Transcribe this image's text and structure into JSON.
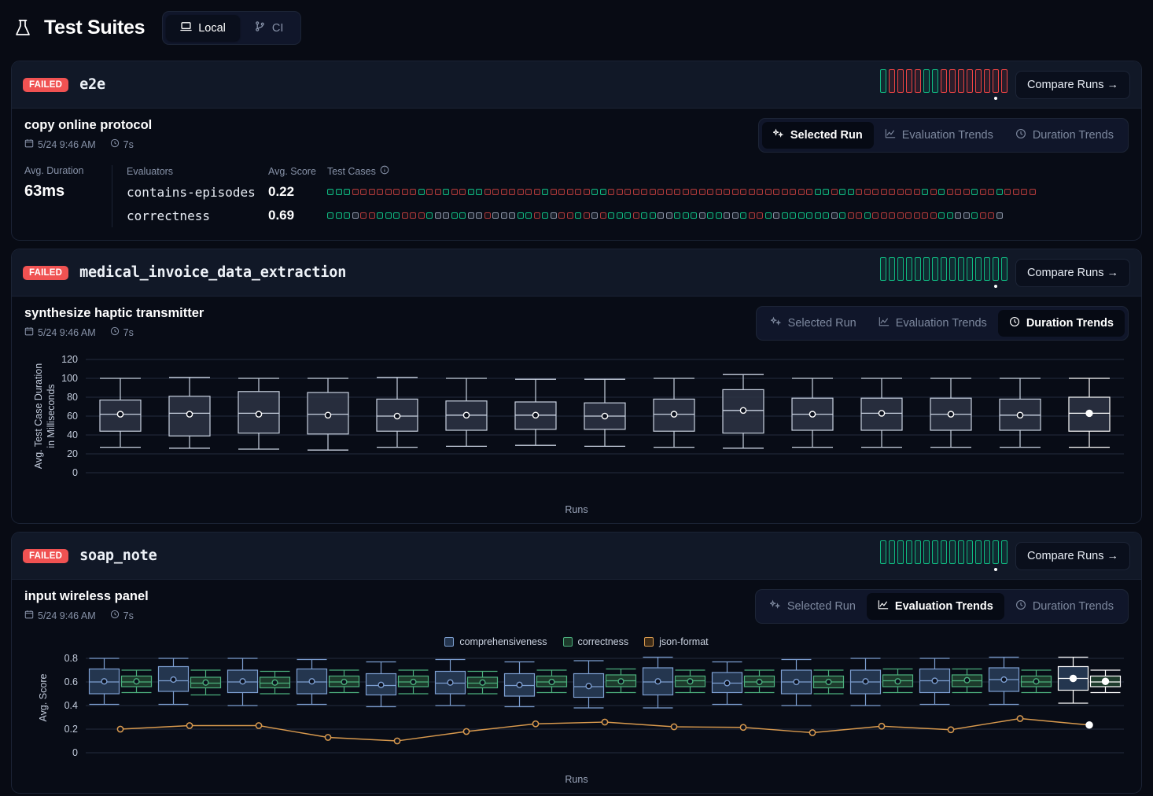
{
  "header": {
    "title": "Test Suites",
    "flask_icon": "flask-icon",
    "segments": [
      {
        "label": "Local",
        "icon": "laptop-icon",
        "active": true
      },
      {
        "label": "CI",
        "icon": "git-branch-icon",
        "active": false
      }
    ]
  },
  "labels": {
    "compare_runs": "Compare Runs →",
    "status_failed": "FAILED",
    "tab_selected_run": "Selected Run",
    "tab_evaluation_trends": "Evaluation Trends",
    "tab_duration_trends": "Duration Trends",
    "avg_duration": "Avg. Duration",
    "evaluators": "Evaluators",
    "avg_score": "Avg. Score",
    "test_cases": "Test Cases",
    "runs_axis": "Runs"
  },
  "colors": {
    "fail": "#f05252",
    "pass": "#10b981",
    "comprehensiveness": "#7d9fd1",
    "correctness": "#4caf7d",
    "json_format": "#d99a4e",
    "selected": "#ffffff"
  },
  "suites": [
    {
      "name": "e2e",
      "status": "FAILED",
      "run_bars": [
        "pass",
        "fail",
        "fail",
        "fail",
        "fail",
        "pass",
        "pass",
        "fail",
        "fail",
        "fail",
        "fail",
        "fail",
        "fail",
        "fail",
        "fail"
      ],
      "selected_bar_index": 13,
      "run": {
        "title": "copy online protocol",
        "date": "5/24 9:46 AM",
        "duration": "7s"
      },
      "active_tab": "Selected Run",
      "avg_duration": "63ms",
      "evaluators": [
        {
          "name": "contains-episodes",
          "avg_score": "0.22",
          "cases": [
            "p",
            "p",
            "p",
            "f",
            "f",
            "f",
            "f",
            "f",
            "f",
            "f",
            "f",
            "p",
            "f",
            "f",
            "p",
            "f",
            "f",
            "p",
            "p",
            "f",
            "f",
            "f",
            "f",
            "f",
            "f",
            "f",
            "p",
            "f",
            "f",
            "f",
            "f",
            "f",
            "p",
            "p",
            "f",
            "f",
            "f",
            "f",
            "f",
            "f",
            "f",
            "f",
            "f",
            "f",
            "f",
            "f",
            "f",
            "f",
            "f",
            "f",
            "f",
            "f",
            "f",
            "f",
            "f",
            "f",
            "f",
            "f",
            "f",
            "p",
            "p",
            "f",
            "p",
            "p",
            "f",
            "f",
            "f",
            "f",
            "f",
            "f",
            "f",
            "f",
            "p",
            "f",
            "p",
            "f",
            "f",
            "f",
            "p",
            "f",
            "f",
            "p",
            "f",
            "f",
            "f",
            "f"
          ]
        },
        {
          "name": "correctness",
          "avg_score": "0.69",
          "cases": [
            "p",
            "p",
            "p",
            "n",
            "f",
            "f",
            "p",
            "p",
            "p",
            "f",
            "f",
            "f",
            "p",
            "n",
            "n",
            "p",
            "p",
            "n",
            "n",
            "f",
            "n",
            "n",
            "n",
            "p",
            "p",
            "f",
            "p",
            "n",
            "f",
            "f",
            "p",
            "f",
            "n",
            "f",
            "p",
            "p",
            "p",
            "f",
            "p",
            "p",
            "n",
            "n",
            "p",
            "p",
            "p",
            "n",
            "p",
            "p",
            "n",
            "n",
            "p",
            "f",
            "f",
            "p",
            "n",
            "p",
            "p",
            "p",
            "p",
            "p",
            "p",
            "n",
            "p",
            "f",
            "f",
            "p",
            "f",
            "f",
            "f",
            "f",
            "f",
            "f",
            "f",
            "f",
            "p",
            "p",
            "n",
            "n",
            "p",
            "f",
            "f",
            "n"
          ]
        }
      ]
    },
    {
      "name": "medical_invoice_data_extraction",
      "status": "FAILED",
      "run_bars": [
        "pass",
        "pass",
        "pass",
        "pass",
        "pass",
        "pass",
        "pass",
        "pass",
        "pass",
        "pass",
        "pass",
        "pass",
        "pass",
        "pass",
        "pass"
      ],
      "selected_bar_index": 13,
      "run": {
        "title": "synthesize haptic transmitter",
        "date": "5/24 9:46 AM",
        "duration": "7s"
      },
      "active_tab": "Duration Trends"
    },
    {
      "name": "soap_note",
      "status": "FAILED",
      "run_bars": [
        "pass",
        "pass",
        "pass",
        "pass",
        "pass",
        "pass",
        "pass",
        "pass",
        "pass",
        "pass",
        "pass",
        "pass",
        "pass",
        "pass",
        "pass"
      ],
      "selected_bar_index": 13,
      "run": {
        "title": "input wireless panel",
        "date": "5/24 9:46 AM",
        "duration": "7s"
      },
      "active_tab": "Evaluation Trends"
    }
  ],
  "chart_data": [
    {
      "type": "box",
      "chart_id": "duration-trends",
      "title": "",
      "xlabel": "Runs",
      "ylabel": "Avg. Test Case Duration in Milliseconds",
      "ylim": [
        0,
        120
      ],
      "yticks": [
        0,
        20,
        40,
        60,
        80,
        100,
        120
      ],
      "grid": true,
      "selected_index": 14,
      "boxes": [
        {
          "min": 27,
          "q1": 44,
          "median": 62,
          "q3": 77,
          "max": 100,
          "mean": 62
        },
        {
          "min": 26,
          "q1": 39,
          "median": 63,
          "q3": 81,
          "max": 101,
          "mean": 62
        },
        {
          "min": 25,
          "q1": 42,
          "median": 63,
          "q3": 86,
          "max": 100,
          "mean": 62
        },
        {
          "min": 24,
          "q1": 41,
          "median": 62,
          "q3": 85,
          "max": 100,
          "mean": 61
        },
        {
          "min": 27,
          "q1": 44,
          "median": 60,
          "q3": 78,
          "max": 101,
          "mean": 60
        },
        {
          "min": 28,
          "q1": 45,
          "median": 61,
          "q3": 76,
          "max": 100,
          "mean": 61
        },
        {
          "min": 29,
          "q1": 46,
          "median": 61,
          "q3": 75,
          "max": 99,
          "mean": 61
        },
        {
          "min": 28,
          "q1": 46,
          "median": 60,
          "q3": 74,
          "max": 99,
          "mean": 60
        },
        {
          "min": 27,
          "q1": 44,
          "median": 62,
          "q3": 78,
          "max": 100,
          "mean": 62
        },
        {
          "min": 26,
          "q1": 42,
          "median": 66,
          "q3": 88,
          "max": 104,
          "mean": 66
        },
        {
          "min": 27,
          "q1": 45,
          "median": 62,
          "q3": 79,
          "max": 100,
          "mean": 62
        },
        {
          "min": 27,
          "q1": 45,
          "median": 63,
          "q3": 79,
          "max": 100,
          "mean": 63
        },
        {
          "min": 27,
          "q1": 45,
          "median": 62,
          "q3": 79,
          "max": 100,
          "mean": 62
        },
        {
          "min": 27,
          "q1": 45,
          "median": 61,
          "q3": 78,
          "max": 100,
          "mean": 61
        },
        {
          "min": 27,
          "q1": 44,
          "median": 63,
          "q3": 80,
          "max": 100,
          "mean": 63
        }
      ]
    },
    {
      "type": "box",
      "chart_id": "evaluation-trends",
      "title": "",
      "xlabel": "Runs",
      "ylabel": "Avg. Score",
      "ylim": [
        0,
        0.8
      ],
      "yticks": [
        0,
        0.2,
        0.4,
        0.6,
        0.8
      ],
      "grid": true,
      "selected_index": 14,
      "legend": [
        "comprehensiveness",
        "correctness",
        "json-format"
      ],
      "legend_position": "top-center",
      "series": [
        {
          "name": "comprehensiveness",
          "color": "#7d9fd1",
          "kind": "box",
          "boxes": [
            {
              "min": 0.41,
              "q1": 0.5,
              "median": 0.6,
              "q3": 0.71,
              "max": 0.8,
              "mean": 0.605
            },
            {
              "min": 0.41,
              "q1": 0.52,
              "median": 0.61,
              "q3": 0.73,
              "max": 0.8,
              "mean": 0.62
            },
            {
              "min": 0.4,
              "q1": 0.51,
              "median": 0.6,
              "q3": 0.7,
              "max": 0.8,
              "mean": 0.605
            },
            {
              "min": 0.41,
              "q1": 0.5,
              "median": 0.6,
              "q3": 0.71,
              "max": 0.79,
              "mean": 0.605
            },
            {
              "min": 0.39,
              "q1": 0.49,
              "median": 0.57,
              "q3": 0.67,
              "max": 0.77,
              "mean": 0.575
            },
            {
              "min": 0.4,
              "q1": 0.5,
              "median": 0.59,
              "q3": 0.69,
              "max": 0.79,
              "mean": 0.595
            },
            {
              "min": 0.39,
              "q1": 0.48,
              "median": 0.57,
              "q3": 0.67,
              "max": 0.77,
              "mean": 0.575
            },
            {
              "min": 0.38,
              "q1": 0.47,
              "median": 0.56,
              "q3": 0.67,
              "max": 0.78,
              "mean": 0.565
            },
            {
              "min": 0.38,
              "q1": 0.49,
              "median": 0.6,
              "q3": 0.72,
              "max": 0.81,
              "mean": 0.605
            },
            {
              "min": 0.41,
              "q1": 0.51,
              "median": 0.59,
              "q3": 0.68,
              "max": 0.77,
              "mean": 0.59
            },
            {
              "min": 0.4,
              "q1": 0.5,
              "median": 0.6,
              "q3": 0.7,
              "max": 0.79,
              "mean": 0.6
            },
            {
              "min": 0.4,
              "q1": 0.5,
              "median": 0.6,
              "q3": 0.7,
              "max": 0.8,
              "mean": 0.605
            },
            {
              "min": 0.41,
              "q1": 0.51,
              "median": 0.61,
              "q3": 0.71,
              "max": 0.8,
              "mean": 0.61
            },
            {
              "min": 0.41,
              "q1": 0.52,
              "median": 0.62,
              "q3": 0.72,
              "max": 0.81,
              "mean": 0.62
            },
            {
              "min": 0.42,
              "q1": 0.53,
              "median": 0.63,
              "q3": 0.73,
              "max": 0.81,
              "mean": 0.63
            }
          ]
        },
        {
          "name": "correctness",
          "color": "#4caf7d",
          "kind": "box",
          "boxes": [
            {
              "min": 0.51,
              "q1": 0.56,
              "median": 0.6,
              "q3": 0.65,
              "max": 0.7,
              "mean": 0.605
            },
            {
              "min": 0.49,
              "q1": 0.55,
              "median": 0.59,
              "q3": 0.64,
              "max": 0.7,
              "mean": 0.595
            },
            {
              "min": 0.5,
              "q1": 0.55,
              "median": 0.59,
              "q3": 0.64,
              "max": 0.69,
              "mean": 0.595
            },
            {
              "min": 0.51,
              "q1": 0.56,
              "median": 0.6,
              "q3": 0.65,
              "max": 0.7,
              "mean": 0.6
            },
            {
              "min": 0.5,
              "q1": 0.56,
              "median": 0.6,
              "q3": 0.65,
              "max": 0.7,
              "mean": 0.6
            },
            {
              "min": 0.5,
              "q1": 0.55,
              "median": 0.59,
              "q3": 0.64,
              "max": 0.69,
              "mean": 0.595
            },
            {
              "min": 0.51,
              "q1": 0.56,
              "median": 0.6,
              "q3": 0.65,
              "max": 0.7,
              "mean": 0.6
            },
            {
              "min": 0.51,
              "q1": 0.56,
              "median": 0.61,
              "q3": 0.66,
              "max": 0.71,
              "mean": 0.605
            },
            {
              "min": 0.51,
              "q1": 0.56,
              "median": 0.61,
              "q3": 0.65,
              "max": 0.7,
              "mean": 0.605
            },
            {
              "min": 0.51,
              "q1": 0.56,
              "median": 0.6,
              "q3": 0.65,
              "max": 0.7,
              "mean": 0.6
            },
            {
              "min": 0.5,
              "q1": 0.55,
              "median": 0.6,
              "q3": 0.65,
              "max": 0.7,
              "mean": 0.6
            },
            {
              "min": 0.51,
              "q1": 0.56,
              "median": 0.61,
              "q3": 0.66,
              "max": 0.71,
              "mean": 0.605
            },
            {
              "min": 0.51,
              "q1": 0.56,
              "median": 0.61,
              "q3": 0.66,
              "max": 0.71,
              "mean": 0.615
            },
            {
              "min": 0.51,
              "q1": 0.56,
              "median": 0.6,
              "q3": 0.65,
              "max": 0.7,
              "mean": 0.605
            },
            {
              "min": 0.51,
              "q1": 0.56,
              "median": 0.6,
              "q3": 0.65,
              "max": 0.7,
              "mean": 0.605
            }
          ]
        },
        {
          "name": "json-format",
          "color": "#d99a4e",
          "kind": "line",
          "values": [
            0.2,
            0.23,
            0.23,
            0.13,
            0.1,
            0.18,
            0.245,
            0.26,
            0.22,
            0.215,
            0.17,
            0.225,
            0.195,
            0.29,
            0.235
          ]
        }
      ]
    }
  ]
}
